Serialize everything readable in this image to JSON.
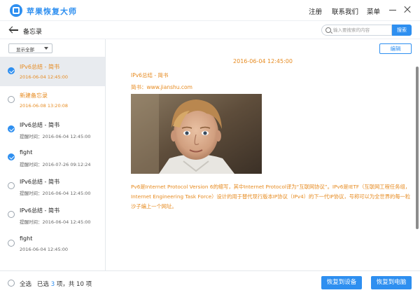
{
  "app": {
    "title": "苹果恢复大师",
    "nav": [
      "注册",
      "联系我们",
      "菜单"
    ]
  },
  "header": {
    "page_title": "备忘录",
    "search_placeholder": "输入要搜索的内容",
    "search_button": "搜索"
  },
  "filter": {
    "selected": "显示全部"
  },
  "notes": [
    {
      "title": "IPv6总结 - 简书",
      "sub": "2016-06-04 12:45:00",
      "checked": true,
      "selected": true,
      "orange": true
    },
    {
      "title": "新建备忘录",
      "sub": "2016-06-08 13:20:08",
      "checked": false,
      "selected": false,
      "orange": true
    },
    {
      "title": "IPv6总结 - 简书",
      "sub": "提醒时间：2016-06-04 12:45:00",
      "checked": true,
      "selected": false,
      "orange": false
    },
    {
      "title": "fight",
      "sub": "提醒时间：2016-07-26 09:12:24",
      "checked": true,
      "selected": false,
      "orange": false
    },
    {
      "title": "IPv6总结 - 简书",
      "sub": "提醒时间：2016-06-04 12:45:00",
      "checked": false,
      "selected": false,
      "orange": false
    },
    {
      "title": "IPv6总结 - 简书",
      "sub": "提醒时间：2016-06-04 12:45:00",
      "checked": false,
      "selected": false,
      "orange": false
    },
    {
      "title": "fight",
      "sub": "2016-06-04 12:45:00",
      "checked": false,
      "selected": false,
      "orange": false
    }
  ],
  "detail": {
    "edit_button": "编辑",
    "date": "2016-06-04 12:45:00",
    "title": "IPv6总结 - 简书",
    "source": "简书：www.jianshu.com",
    "body": "Pv6是Internet Protocol Version 6的缩写，其中Internet Protocol译为“互联网协议”。IPv6是IETF（互联网工程任务组，Internet Engineering Task Force）设计的用于替代现行版本IP协议（IPv4）的下一代IP协议，号称可以为全世界的每一粒沙子编上一个网址。"
  },
  "footer": {
    "select_all": "全选",
    "selected_prefix": "已选",
    "selected_count": "3",
    "selected_suffix": "项，共 10 项",
    "restore_device": "恢复到设备",
    "restore_pc": "恢复到电脑"
  },
  "colors": {
    "accent": "#2e8ff0",
    "orange_text": "#e68a1f",
    "selected_row": "#e8ebef"
  }
}
